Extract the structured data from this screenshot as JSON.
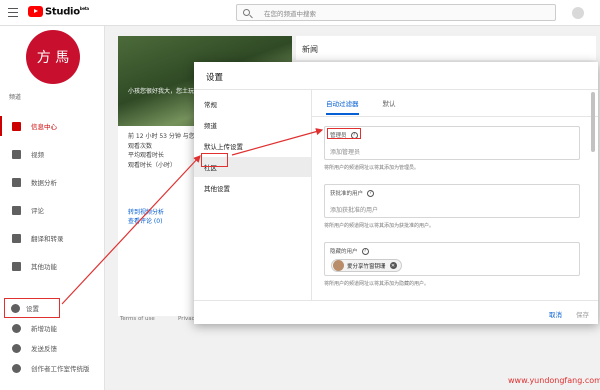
{
  "topbar": {
    "logo_text": "Studio",
    "logo_sup": "beta",
    "search_placeholder": "在您的频道中搜索"
  },
  "sidebar": {
    "avatar_text": "方 馬",
    "channel_label": "频道",
    "items": [
      {
        "label": "信息中心",
        "active": true
      },
      {
        "label": "视频",
        "active": false
      },
      {
        "label": "数据分析",
        "active": false
      },
      {
        "label": "评论",
        "active": false
      },
      {
        "label": "翻译和转录",
        "active": false
      },
      {
        "label": "其他功能",
        "active": false
      }
    ],
    "bottom_items": [
      {
        "label": "设置"
      },
      {
        "label": "新增功能"
      },
      {
        "label": "发送反馈"
      },
      {
        "label": "创作者工作室传统版"
      }
    ]
  },
  "background": {
    "video_caption": "小孩您很好我大，您土玩意",
    "stats": [
      "前 12 小时 53 分钟 与您频道",
      "观看次数",
      "平均观看时长",
      "观看时长（小时）"
    ],
    "links": [
      "转到视频分析",
      "查看评论 (0)"
    ],
    "news_title": "新闻",
    "footer_terms": "Terms of use",
    "footer_privacy": "Privacy"
  },
  "modal": {
    "title": "设置",
    "nav": [
      {
        "label": "常规",
        "active": false
      },
      {
        "label": "频道",
        "active": false
      },
      {
        "label": "默认上传设置",
        "active": false
      },
      {
        "label": "社区",
        "active": true
      },
      {
        "label": "其他设置",
        "active": false
      }
    ],
    "tabs": [
      {
        "label": "自动过滤器",
        "active": true
      },
      {
        "label": "默认",
        "active": false
      }
    ],
    "fields": [
      {
        "label": "管理员",
        "placeholder": "添加管理员",
        "note": "将所用户的频道网址以将其添加为管理员。"
      },
      {
        "label": "获批准的用户",
        "placeholder": "添加获批准的用户",
        "note": "将所用户的频道网址以将其添加为获批准的用户。"
      },
      {
        "label": "隐藏的用户",
        "chip": "爱分享竹窗钥珊",
        "note": "将所用户的频道网址以将其添加为隐藏的用户。"
      }
    ],
    "cancel_label": "取消",
    "save_label": "保存"
  },
  "watermark": "www.yundongfang.com",
  "colors": {
    "accent": "#065fd4",
    "brand_red": "#ff0000",
    "annotation_red": "#e03030"
  }
}
